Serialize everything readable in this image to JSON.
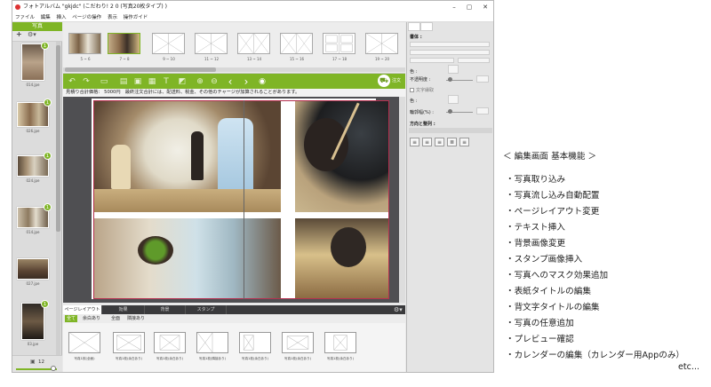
{
  "window": {
    "title": "フォトアルバム \"gkjdc\" (こだわり! 2 0 (写真20枚タイプ) )",
    "min": "–",
    "max": "▢",
    "close": "✕"
  },
  "menu": [
    "ファイル",
    "編集",
    "挿入",
    "ページの操作",
    "表示",
    "操作ガイド"
  ],
  "left_panel": {
    "title": "写真",
    "add": "+",
    "photos": [
      {
        "caption": "014.jpe",
        "badge": "1"
      },
      {
        "caption": "026.jpe",
        "badge": "1"
      },
      {
        "caption": "024.jpe",
        "badge": "1"
      },
      {
        "caption": "014.jpe",
        "badge": "1"
      },
      {
        "caption": "027.jpe",
        "badge": ""
      },
      {
        "caption": "03.jpe",
        "badge": "1"
      }
    ],
    "count": "12"
  },
  "spreads": [
    "5 ~ 6",
    "7 ~ 8",
    "9 ~ 10",
    "11 ~ 12",
    "13 ~ 14",
    "15 ~ 16",
    "17 ~ 18",
    "19 ~ 20"
  ],
  "toolbar": {
    "cart_label": "注文"
  },
  "notice": "見積り合計価格： 5000円　最終注文合計には、配送料、税金、その他のチャージが加算されることがあります。",
  "bottom_tabs": [
    "ページレイアウト",
    "効果",
    "背景",
    "スタンプ"
  ],
  "filters": [
    "全て",
    "余白あり",
    "全面",
    "隣接あり"
  ],
  "layouts": [
    "写真1枚(全面)",
    "写真1枚(余白あり)",
    "写真1枚(余白あり)",
    "写真1枚(隣接あり)",
    "写真1枚(余白あり)",
    "写真1枚(余白あり)",
    "写真1枚(余白あり)"
  ],
  "right_panel": {
    "font_label": "書体 :",
    "color_label": "色 :",
    "opacity_label": "不透明度 :",
    "outline_label": "文字縁取",
    "outline_color_label": "色 :",
    "outline_width_label": "輪郭幅(%) :",
    "align_label": "方向と整列 :"
  },
  "features": {
    "title": "＜ 編集画面 基本機能 ＞",
    "items": [
      "・写真取り込み",
      "・写真流し込み自動配置",
      "・ページレイアウト変更",
      "・テキスト挿入",
      "・背景画像変更",
      "・スタンプ画像挿入",
      "・写真へのマスク効果追加",
      "・表紙タイトルの編集",
      "・背文字タイトルの編集",
      "・写真の任意追加",
      "・プレビュー確認",
      "・カレンダーの編集（カレンダー用Appのみ）"
    ],
    "etc": "etc..."
  },
  "colors": {
    "accent": "#7fb526",
    "canvas_bg": "#4f4f52",
    "frame": "#b52f4f"
  }
}
